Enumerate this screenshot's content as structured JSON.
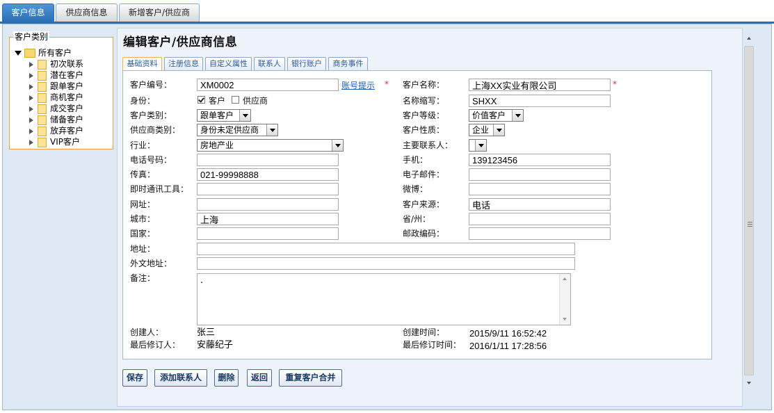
{
  "top_tabs": [
    "客户信息",
    "供应商信息",
    "新增客户/供应商"
  ],
  "tree": {
    "legend": "客户类别",
    "root": "所有客户",
    "items": [
      "初次联系",
      "潜在客户",
      "跟单客户",
      "商机客户",
      "成交客户",
      "储备客户",
      "放弃客户",
      "VIP客户"
    ]
  },
  "page_title": "编辑客户/供应商信息",
  "sub_tabs": [
    "基础资料",
    "注册信息",
    "自定义属性",
    "联系人",
    "银行账户",
    "商务事件"
  ],
  "form": {
    "labels": {
      "customer_no": "客户编号：",
      "identity": "身份：",
      "customer_category": "客户类别：",
      "supplier_category": "供应商类别：",
      "industry": "行业：",
      "phone": "电话号码：",
      "fax": "传真：",
      "im": "即时通讯工具：",
      "website": "网址：",
      "city": "城市：",
      "country": "国家：",
      "address": "地址：",
      "foreign_address": "外文地址：",
      "remarks": "备注：",
      "created_by": "创建人：",
      "modified_by": "最后修订人：",
      "customer_name": "客户名称：",
      "short_name": "名称缩写：",
      "customer_level": "客户等级：",
      "customer_nature": "客户性质：",
      "main_contact": "主要联系人：",
      "mobile": "手机：",
      "email": "电子邮件：",
      "weibo": "微博：",
      "source": "客户来源：",
      "province": "省/州：",
      "postcode": "邮政编码：",
      "created_time": "创建时间：",
      "modified_time": "最后修订时间："
    },
    "values": {
      "customer_no": "XM0002",
      "account_hint": "账号提示",
      "required_mark": "*",
      "identity_customer": "客户",
      "identity_supplier": "供应商",
      "identity_customer_checked": true,
      "identity_supplier_checked": false,
      "customer_category": "跟单客户",
      "supplier_category": "身份未定供应商",
      "industry": "房地产业",
      "phone": "",
      "fax": "021-99998888",
      "im": "",
      "website": "",
      "city": "上海",
      "country": "",
      "address": "",
      "foreign_address": "",
      "remarks": ".",
      "created_by": "张三",
      "modified_by": "安藤纪子",
      "customer_name": "上海XX实业有限公司",
      "short_name": "SHXX",
      "customer_level": "价值客户",
      "customer_nature": "企业",
      "main_contact": "",
      "mobile": "139123456",
      "email": "",
      "weibo": "",
      "source": "电话",
      "province": "",
      "postcode": "",
      "created_time": "2015/9/11 16:52:42",
      "modified_time": "2016/1/11 17:28:56"
    }
  },
  "buttons": [
    "保存",
    "添加联系人",
    "删除",
    "返回",
    "重复客户合并"
  ],
  "colors": {
    "tab_active": "#2a6fb8",
    "frame_bg": "#dfe9f5",
    "required": "#e03030",
    "link": "#1c5fb8",
    "tree_border": "#e8a33c"
  }
}
